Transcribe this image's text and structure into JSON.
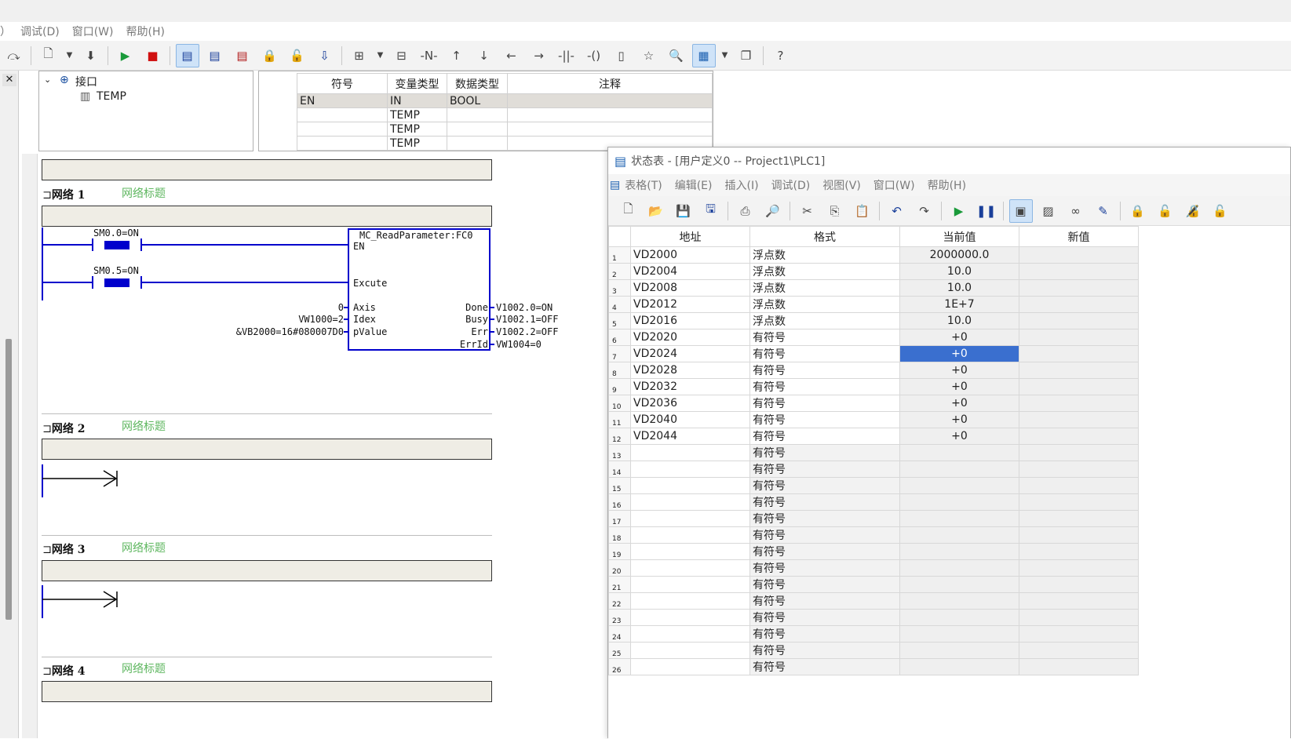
{
  "main_menu": [
    "）",
    "调试(D)",
    "窗口(W)",
    "帮助(H)"
  ],
  "main_toolbar_icons": [
    "redo-icon",
    "new-icon",
    "dropdown-icon",
    "insert-icon",
    "run-icon",
    "stop-icon",
    "program-block-icon",
    "data-block-icon",
    "symbol-table-icon",
    "lock-icon",
    "unlock-icon",
    "download-icon",
    "insert-network-icon",
    "dropdown-icon",
    "delete-network-icon",
    "negate-icon",
    "line-up-icon",
    "line-down-icon",
    "line-left-icon",
    "line-right-icon",
    "contact-icon",
    "coil-icon",
    "box-icon",
    "favorite-icon",
    "zoom-icon",
    "status-table-icon",
    "dropdown-icon",
    "window-icon",
    "help-icon"
  ],
  "tree": {
    "root": "接口",
    "child": "TEMP"
  },
  "interface_table": {
    "headers": [
      "符号",
      "变量类型",
      "数据类型",
      "注释"
    ],
    "rows": [
      [
        "EN",
        "IN",
        "BOOL",
        ""
      ],
      [
        "",
        "TEMP",
        "",
        ""
      ],
      [
        "",
        "TEMP",
        "",
        ""
      ],
      [
        "",
        "TEMP",
        "",
        ""
      ]
    ]
  },
  "networks": [
    {
      "label": "网络 1",
      "title": "网络标题"
    },
    {
      "label": "网络 2",
      "title": "网络标题"
    },
    {
      "label": "网络 3",
      "title": "网络标题"
    },
    {
      "label": "网络 4",
      "title": "网络标题"
    }
  ],
  "ladder": {
    "contact1": "SM0.0=ON",
    "contact2": "SM0.5=ON",
    "block_name": "MC_ReadParameter:FC0",
    "en": "EN",
    "excute": "Excute",
    "in_values": [
      "0",
      "VW1000=2",
      "&VB2000=16#080007D0"
    ],
    "in_pins": [
      "Axis",
      "Idex",
      "pValue"
    ],
    "out_pins": [
      "Done",
      "Busy",
      "Err",
      "ErrId"
    ],
    "out_values": [
      "V1002.0=ON",
      "V1002.1=OFF",
      "V1002.2=OFF",
      "VW1004=0"
    ]
  },
  "status_window": {
    "title": "状态表 - [用户定义0 -- Project1\\PLC1]",
    "menu": [
      "表格(T)",
      "编辑(E)",
      "插入(I)",
      "调试(D)",
      "视图(V)",
      "窗口(W)",
      "帮助(H)"
    ],
    "toolbar_icons": [
      "new-icon",
      "open-icon",
      "save-icon",
      "save-all-icon",
      "print-icon",
      "print-preview-icon",
      "cut-icon",
      "copy-icon",
      "paste-icon",
      "undo-icon",
      "redo-icon",
      "run-icon",
      "pause-icon",
      "chart-status-icon",
      "trend-icon",
      "glasses-icon",
      "pen-icon",
      "lock-icon",
      "unlock-icon",
      "lock-download-icon",
      "unlock-all-icon"
    ],
    "headers": [
      "地址",
      "格式",
      "当前值",
      "新值"
    ],
    "rows": [
      {
        "n": "1",
        "addr": "VD2000",
        "fmt": "浮点数",
        "cur": "2000000.0"
      },
      {
        "n": "2",
        "addr": "VD2004",
        "fmt": "浮点数",
        "cur": "10.0"
      },
      {
        "n": "3",
        "addr": "VD2008",
        "fmt": "浮点数",
        "cur": "10.0"
      },
      {
        "n": "4",
        "addr": "VD2012",
        "fmt": "浮点数",
        "cur": "1E+7"
      },
      {
        "n": "5",
        "addr": "VD2016",
        "fmt": "浮点数",
        "cur": "10.0"
      },
      {
        "n": "6",
        "addr": "VD2020",
        "fmt": "有符号",
        "cur": "+0"
      },
      {
        "n": "7",
        "addr": "VD2024",
        "fmt": "有符号",
        "cur": "+0"
      },
      {
        "n": "8",
        "addr": "VD2028",
        "fmt": "有符号",
        "cur": "+0"
      },
      {
        "n": "9",
        "addr": "VD2032",
        "fmt": "有符号",
        "cur": "+0"
      },
      {
        "n": "10",
        "addr": "VD2036",
        "fmt": "有符号",
        "cur": "+0"
      },
      {
        "n": "11",
        "addr": "VD2040",
        "fmt": "有符号",
        "cur": "+0"
      },
      {
        "n": "12",
        "addr": "VD2044",
        "fmt": "有符号",
        "cur": "+0"
      },
      {
        "n": "13",
        "addr": "",
        "fmt": "有符号",
        "cur": ""
      },
      {
        "n": "14",
        "addr": "",
        "fmt": "有符号",
        "cur": ""
      },
      {
        "n": "15",
        "addr": "",
        "fmt": "有符号",
        "cur": ""
      },
      {
        "n": "16",
        "addr": "",
        "fmt": "有符号",
        "cur": ""
      },
      {
        "n": "17",
        "addr": "",
        "fmt": "有符号",
        "cur": ""
      },
      {
        "n": "18",
        "addr": "",
        "fmt": "有符号",
        "cur": ""
      },
      {
        "n": "19",
        "addr": "",
        "fmt": "有符号",
        "cur": ""
      },
      {
        "n": "20",
        "addr": "",
        "fmt": "有符号",
        "cur": ""
      },
      {
        "n": "21",
        "addr": "",
        "fmt": "有符号",
        "cur": ""
      },
      {
        "n": "22",
        "addr": "",
        "fmt": "有符号",
        "cur": ""
      },
      {
        "n": "23",
        "addr": "",
        "fmt": "有符号",
        "cur": ""
      },
      {
        "n": "24",
        "addr": "",
        "fmt": "有符号",
        "cur": ""
      },
      {
        "n": "25",
        "addr": "",
        "fmt": "有符号",
        "cur": ""
      },
      {
        "n": "26",
        "addr": "",
        "fmt": "有符号",
        "cur": ""
      }
    ]
  },
  "colors": {
    "accent": "#3a6fcf",
    "ladder_blue": "#0000cc",
    "network_title": "#5fb760",
    "comment_fill": "#efede5"
  }
}
